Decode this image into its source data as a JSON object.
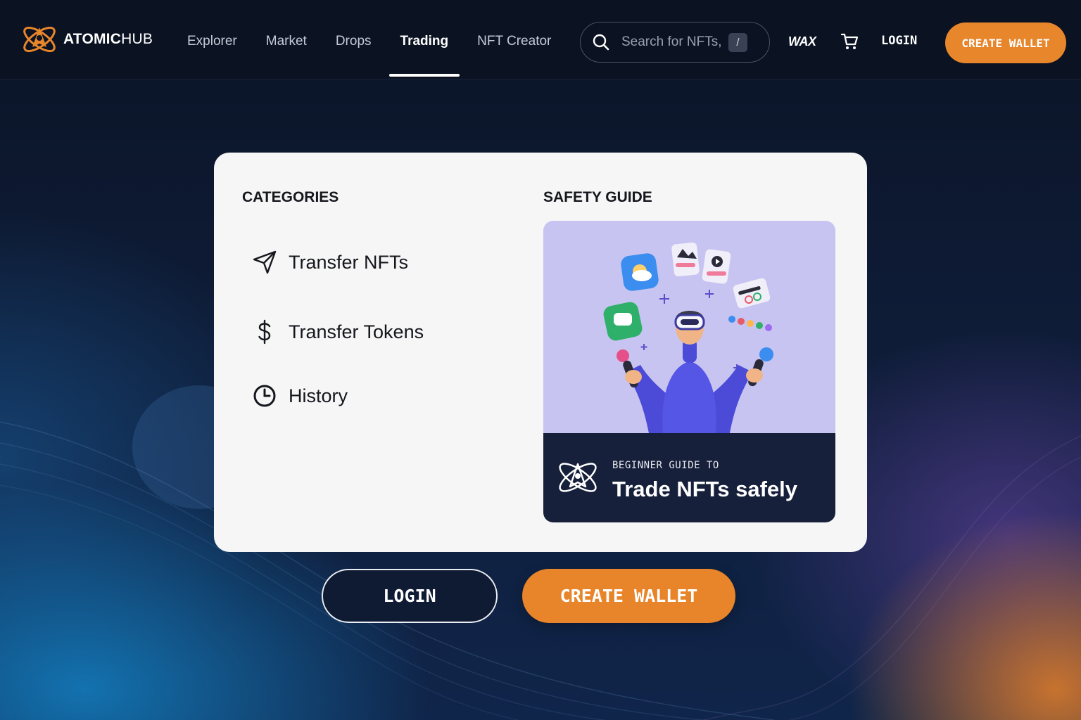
{
  "header": {
    "logo": {
      "bold": "ATOMIC",
      "light": "HUB",
      "icon": "atom-rocket-icon"
    },
    "nav": [
      {
        "label": "Explorer",
        "active": false
      },
      {
        "label": "Market",
        "active": false
      },
      {
        "label": "Drops",
        "active": false
      },
      {
        "label": "Trading",
        "active": true
      },
      {
        "label": "NFT Creator",
        "active": false
      }
    ],
    "search": {
      "placeholder": "Search for NFTs,",
      "shortcut": "/",
      "icon": "search-icon"
    },
    "chain_label": "WAX",
    "cart_icon": "cart-icon",
    "login_label": "LOGIN",
    "create_wallet_label": "CREATE WALLET",
    "accent": "#e8862c"
  },
  "card": {
    "categories_title": "CATEGORIES",
    "categories": [
      {
        "label": "Transfer NFTs",
        "icon": "send-icon"
      },
      {
        "label": "Transfer Tokens",
        "icon": "dollar-icon"
      },
      {
        "label": "History",
        "icon": "clock-icon"
      }
    ],
    "safety_title": "SAFETY GUIDE",
    "guide": {
      "subtitle": "BEGINNER GUIDE TO",
      "headline": "Trade NFTs safely",
      "illustration": "vr-person-illustration"
    }
  },
  "actions": {
    "login_label": "LOGIN",
    "create_wallet_label": "CREATE WALLET"
  }
}
